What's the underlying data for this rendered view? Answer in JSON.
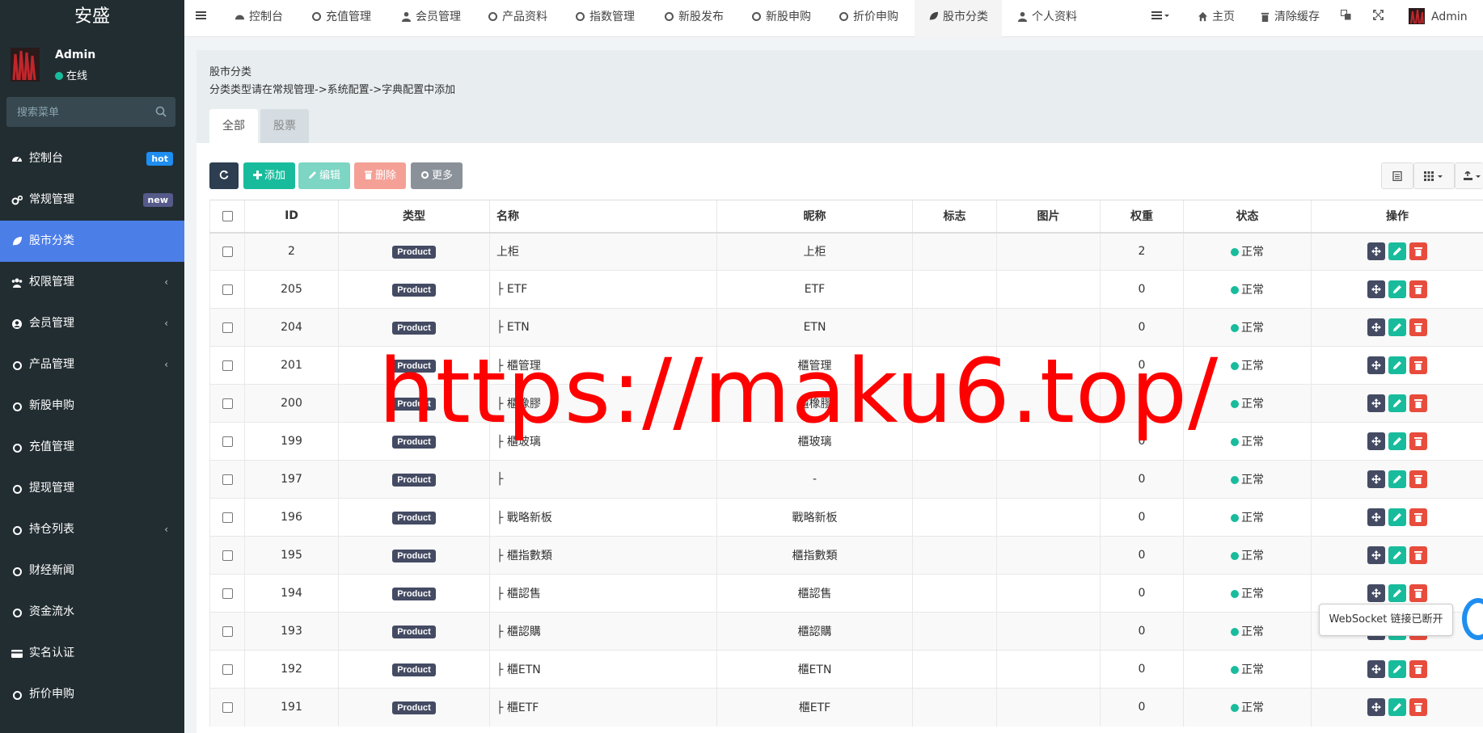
{
  "app": {
    "logo": "安盛"
  },
  "user": {
    "name": "Admin",
    "status": "在线"
  },
  "sidebar": {
    "search_placeholder": "搜索菜单",
    "items": [
      {
        "label": "控制台",
        "icon": "dashboard-icon",
        "badge": "hot"
      },
      {
        "label": "常规管理",
        "icon": "cogs-icon",
        "badge": "new"
      },
      {
        "label": "股市分类",
        "icon": "leaf-icon",
        "active": true
      },
      {
        "label": "权限管理",
        "icon": "group-icon",
        "chevron": true
      },
      {
        "label": "会员管理",
        "icon": "user-circle-icon",
        "chevron": true
      },
      {
        "label": "产品管理",
        "icon": "circle-icon",
        "chevron": true
      },
      {
        "label": "新股申购",
        "icon": "circle-icon"
      },
      {
        "label": "充值管理",
        "icon": "circle-icon"
      },
      {
        "label": "提现管理",
        "icon": "circle-icon"
      },
      {
        "label": "持仓列表",
        "icon": "circle-icon",
        "chevron": true
      },
      {
        "label": "财经新闻",
        "icon": "circle-icon"
      },
      {
        "label": "资金流水",
        "icon": "circle-icon"
      },
      {
        "label": "实名认证",
        "icon": "credit-card-icon"
      },
      {
        "label": "折价申购",
        "icon": "circle-icon"
      }
    ]
  },
  "topnav": {
    "tabs": [
      "控制台",
      "充值管理",
      "会员管理",
      "产品资料",
      "指数管理",
      "新股发布",
      "新股申购",
      "折价申购",
      "股市分类",
      "个人资料"
    ],
    "right": {
      "home": "主页",
      "clear_cache": "清除缓存",
      "admin": "Admin"
    }
  },
  "page": {
    "title": "股市分类",
    "description": "分类类型请在常规管理->系统配置->字典配置中添加",
    "tabs": [
      "全部",
      "股票"
    ]
  },
  "toolbar": {
    "add": "添加",
    "edit": "编辑",
    "delete": "删除",
    "more": "更多"
  },
  "table": {
    "headers": [
      "ID",
      "类型",
      "名称",
      "昵称",
      "标志",
      "图片",
      "权重",
      "状态",
      "操作"
    ],
    "rows": [
      {
        "id": "2",
        "type": "Product",
        "name": "上柜",
        "nickname": "上柜",
        "weight": "2",
        "status": "正常"
      },
      {
        "id": "205",
        "type": "Product",
        "name": "├ ETF",
        "nickname": "ETF",
        "weight": "0",
        "status": "正常"
      },
      {
        "id": "204",
        "type": "Product",
        "name": "├ ETN",
        "nickname": "ETN",
        "weight": "0",
        "status": "正常"
      },
      {
        "id": "201",
        "type": "Product",
        "name": "├ 櫃管理",
        "nickname": "櫃管理",
        "weight": "0",
        "status": "正常"
      },
      {
        "id": "200",
        "type": "Product",
        "name": "├ 櫃橡膠",
        "nickname": "櫃橡膠",
        "weight": "0",
        "status": "正常"
      },
      {
        "id": "199",
        "type": "Product",
        "name": "├ 櫃玻璃",
        "nickname": "櫃玻璃",
        "weight": "0",
        "status": "正常"
      },
      {
        "id": "197",
        "type": "Product",
        "name": "├",
        "nickname": "-",
        "weight": "0",
        "status": "正常"
      },
      {
        "id": "196",
        "type": "Product",
        "name": "├ 戰略新板",
        "nickname": "戰略新板",
        "weight": "0",
        "status": "正常"
      },
      {
        "id": "195",
        "type": "Product",
        "name": "├ 櫃指數類",
        "nickname": "櫃指數類",
        "weight": "0",
        "status": "正常"
      },
      {
        "id": "194",
        "type": "Product",
        "name": "├ 櫃認售",
        "nickname": "櫃認售",
        "weight": "0",
        "status": "正常"
      },
      {
        "id": "193",
        "type": "Product",
        "name": "├ 櫃認購",
        "nickname": "櫃認購",
        "weight": "0",
        "status": "正常"
      },
      {
        "id": "192",
        "type": "Product",
        "name": "├ 櫃ETN",
        "nickname": "櫃ETN",
        "weight": "0",
        "status": "正常"
      },
      {
        "id": "191",
        "type": "Product",
        "name": "├ 櫃ETF",
        "nickname": "櫃ETF",
        "weight": "0",
        "status": "正常"
      }
    ]
  },
  "overlay": {
    "watermark": "https://maku6.top/",
    "websocket_tooltip": "WebSocket 链接已断开"
  },
  "colors": {
    "sidebar_bg": "#222d32",
    "active": "#4c7ee8",
    "success": "#18bc9c",
    "danger": "#e74c3c",
    "dark": "#444b63"
  }
}
